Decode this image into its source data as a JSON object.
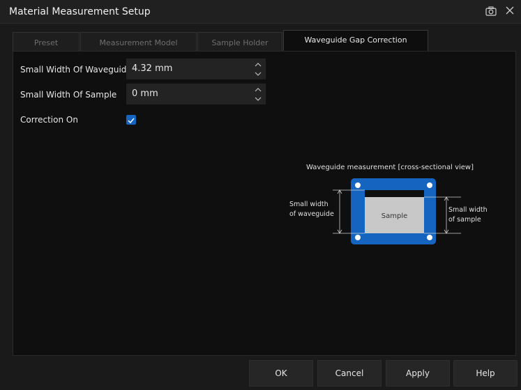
{
  "window": {
    "title": "Material Measurement Setup"
  },
  "tabs": [
    {
      "label": "Preset",
      "active": false
    },
    {
      "label": "Measurement Model",
      "active": false
    },
    {
      "label": "Sample Holder",
      "active": false
    },
    {
      "label": "Waveguide Gap Correction",
      "active": true
    }
  ],
  "fields": {
    "waveguide_width": {
      "label": "Small Width Of Waveguide",
      "value": "4.32 mm"
    },
    "sample_width": {
      "label": "Small Width Of Sample",
      "value": "0 mm"
    },
    "correction_on": {
      "label": "Correction On",
      "checked": true
    }
  },
  "diagram": {
    "caption": "Waveguide measurement [cross-sectional view]",
    "sample_label": "Sample",
    "left_label_line1": "Small width",
    "left_label_line2": "of waveguide",
    "right_label_line1": "Small width",
    "right_label_line2": "of sample"
  },
  "buttons": {
    "ok": "OK",
    "cancel": "Cancel",
    "apply": "Apply",
    "help": "Help"
  },
  "colors": {
    "accent": "#1565c0",
    "background": "#0f0f0f",
    "sample_fill": "#c8c8c8"
  },
  "icons": {
    "camera": "camera-icon",
    "close": "close-icon"
  }
}
